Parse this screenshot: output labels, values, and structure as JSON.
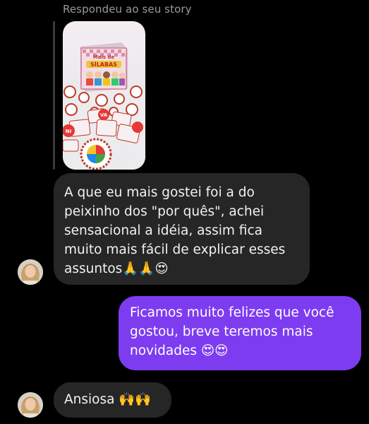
{
  "story_reply": {
    "label": "Respondeu ao seu story",
    "box_title_line1": "Mais de",
    "box_title_line2": "SÍLABAS",
    "card_text_1": "NI",
    "card_text_2": "VA"
  },
  "messages": [
    {
      "direction": "incoming",
      "text": "A que eu mais gostei foi a do peixinho dos \"por quês\", achei sensacional a idéia, assim fica muito mais fácil de explicar esses assuntos🙏🙏😍"
    },
    {
      "direction": "outgoing",
      "text": "Ficamos muito felizes que você gostou, breve teremos mais novidades 😍😍"
    },
    {
      "direction": "incoming",
      "text": "Ansiosa 🙌🙌"
    }
  ],
  "colors": {
    "background": "#000000",
    "incoming_bubble": "#262626",
    "outgoing_bubble": "#7d3cf0"
  }
}
